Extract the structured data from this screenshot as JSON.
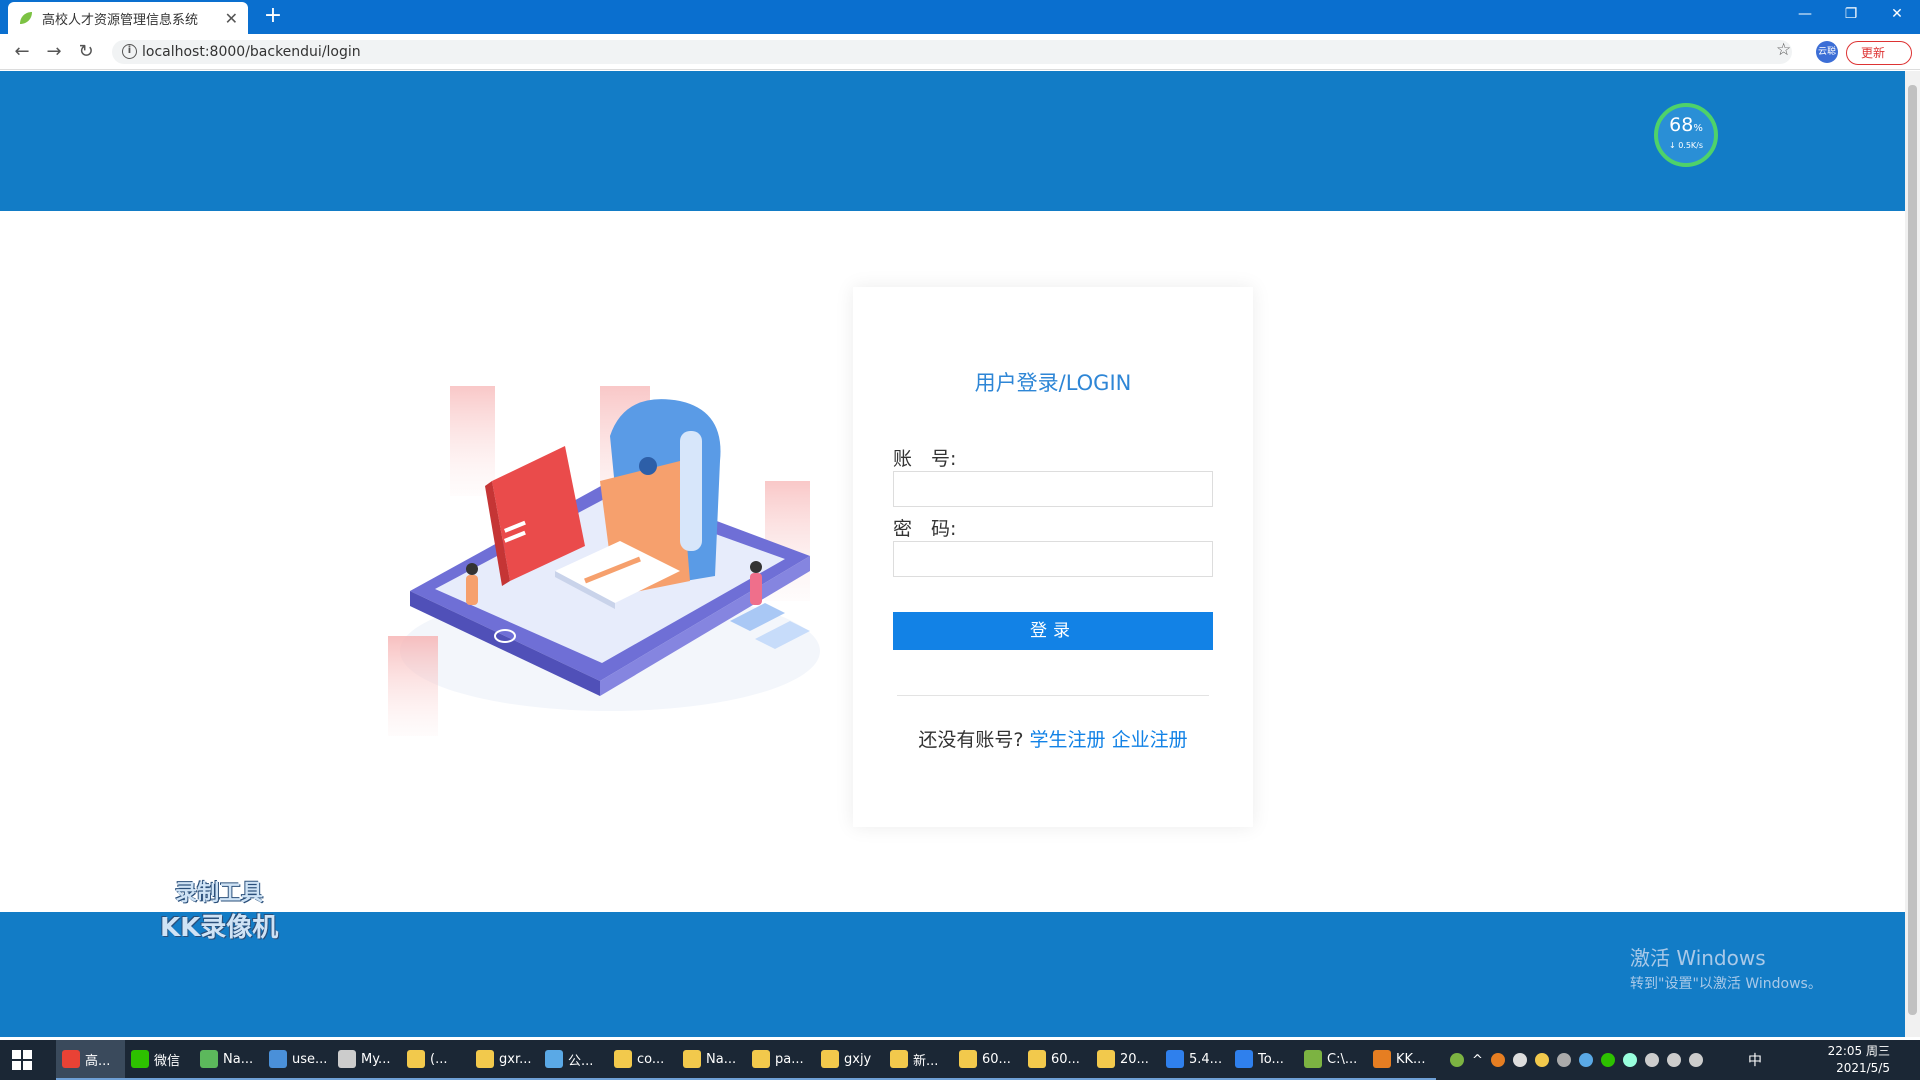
{
  "browser": {
    "tab_title": "高校人才资源管理信息系统",
    "tab_close": "✕",
    "new_tab": "+",
    "url": "localhost:8000/backendui/login",
    "update_label": "更新",
    "profile_label": "云聪"
  },
  "page": {
    "speed_percent": "68",
    "speed_percent_unit": "%",
    "speed_rate": "↓ 0.5K/s",
    "login": {
      "title": "用户登录/LOGIN",
      "account_label": "账　号:",
      "account_value": "",
      "password_label": "密　码:",
      "password_value": "",
      "submit_label": "登录",
      "register_prompt": "还没有账号?",
      "student_register": "学生注册",
      "company_register": "企业注册"
    },
    "watermark": {
      "line1": "录制工具",
      "line2": "KK录像机"
    },
    "activate": {
      "line1": "激活 Windows",
      "line2": "转到\"设置\"以激活 Windows。"
    }
  },
  "taskbar": {
    "items": [
      {
        "label": "高...",
        "icon": "chrome-icon",
        "color": "#e94235"
      },
      {
        "label": "微信",
        "icon": "wechat-icon",
        "color": "#2dc100"
      },
      {
        "label": "Na...",
        "icon": "navicat-icon",
        "color": "#5cb85c"
      },
      {
        "label": "use...",
        "icon": "table-icon",
        "color": "#4a90d9"
      },
      {
        "label": "My...",
        "icon": "pen-icon",
        "color": "#cccccc"
      },
      {
        "label": "(...",
        "icon": "folder-icon",
        "color": "#f2c94c"
      },
      {
        "label": "gxr...",
        "icon": "folder-icon",
        "color": "#f2c94c"
      },
      {
        "label": "公...",
        "icon": "cube-icon",
        "color": "#5aa9e6"
      },
      {
        "label": "co...",
        "icon": "folder-icon",
        "color": "#f2c94c"
      },
      {
        "label": "Na...",
        "icon": "folder-icon",
        "color": "#f2c94c"
      },
      {
        "label": "pa...",
        "icon": "folder-icon",
        "color": "#f2c94c"
      },
      {
        "label": "gxjy",
        "icon": "folder-icon",
        "color": "#f2c94c"
      },
      {
        "label": "新...",
        "icon": "folder-icon",
        "color": "#f2c94c"
      },
      {
        "label": "60...",
        "icon": "folder-icon",
        "color": "#f2c94c"
      },
      {
        "label": "60...",
        "icon": "folder-icon",
        "color": "#f2c94c"
      },
      {
        "label": "20...",
        "icon": "folder-icon",
        "color": "#f2c94c"
      },
      {
        "label": "5.4...",
        "icon": "vscode-icon",
        "color": "#2f80ed"
      },
      {
        "label": "To...",
        "icon": "todo-icon",
        "color": "#2f80ed"
      },
      {
        "label": "C:\\...",
        "icon": "terminal-icon",
        "color": "#7cb342"
      },
      {
        "label": "KK...",
        "icon": "kk-icon",
        "color": "#e67e22"
      }
    ],
    "ime": "中",
    "time": "22:05 周三",
    "date": "2021/5/5"
  }
}
